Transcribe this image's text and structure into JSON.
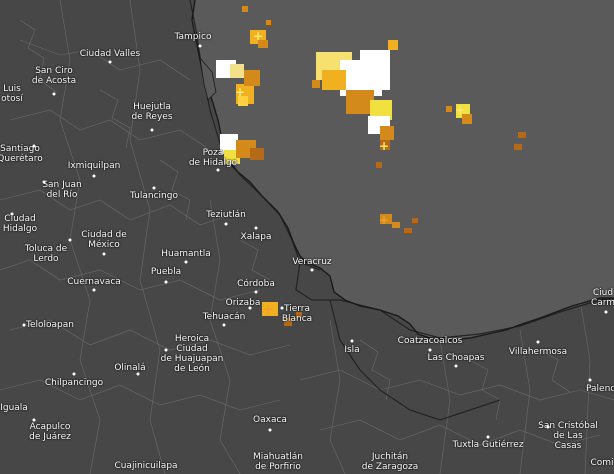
{
  "map": {
    "colors": {
      "land": "#474747",
      "sea": "#5a5a5a",
      "borders": "#6b6b6b",
      "coast": "#1f1f1f",
      "roads": "#2a2a2a"
    },
    "cities": [
      {
        "id": "tampico",
        "label": "Tampico"
      },
      {
        "id": "ciudad-valles",
        "label": "Ciudad Valles"
      },
      {
        "id": "san-ciro",
        "label": "San Ciro\nde Acosta"
      },
      {
        "id": "luis-potosi",
        "label": "Luis\notosí"
      },
      {
        "id": "huejutla",
        "label": "Huejutla\nde Reyes"
      },
      {
        "id": "santiago-queretaro",
        "label": "Santiago\nQuerétaro"
      },
      {
        "id": "ixmiquilpan",
        "label": "Ixmiquilpan"
      },
      {
        "id": "poza-rica",
        "label": "Poza\nde Hidalgo"
      },
      {
        "id": "san-juan-rio",
        "label": "San Juan\ndel Río"
      },
      {
        "id": "tulancingo",
        "label": "Tulancingo"
      },
      {
        "id": "ciudad-hidalgo",
        "label": "Ciudad\nHidalgo"
      },
      {
        "id": "teziutlan",
        "label": "Teziutlán"
      },
      {
        "id": "toluca",
        "label": "Toluca de\nLerdo"
      },
      {
        "id": "ciudad-mexico",
        "label": "Ciudad de\nMéxico"
      },
      {
        "id": "xalapa",
        "label": "Xalapa"
      },
      {
        "id": "huamantla",
        "label": "Huamantla"
      },
      {
        "id": "veracruz",
        "label": "Veracruz"
      },
      {
        "id": "puebla",
        "label": "Puebla"
      },
      {
        "id": "cuernavaca",
        "label": "Cuernavaca"
      },
      {
        "id": "cordoba",
        "label": "Córdoba"
      },
      {
        "id": "orizaba",
        "label": "Orizaba"
      },
      {
        "id": "tierra-blanca",
        "label": "Tierra\nBlanca"
      },
      {
        "id": "tehuacan",
        "label": "Tehuacán"
      },
      {
        "id": "teloloapan",
        "label": "Teloloapan"
      },
      {
        "id": "huajuapan",
        "label": "Heroica\nCiudad\nde Huajuapan\nde León"
      },
      {
        "id": "isla",
        "label": "Isla"
      },
      {
        "id": "coatzacoalcos",
        "label": "Coatzacoalcos"
      },
      {
        "id": "las-choapas",
        "label": "Las Choapas"
      },
      {
        "id": "villahermosa",
        "label": "Villahermosa"
      },
      {
        "id": "chilpancingo",
        "label": "Chilpancingo"
      },
      {
        "id": "olinala",
        "label": "Olinalá"
      },
      {
        "id": "acapulco",
        "label": "Acapulco\nde Juárez"
      },
      {
        "id": "oaxaca",
        "label": "Oaxaca"
      },
      {
        "id": "miahuatlan",
        "label": "Miahuatlán\nde Porfirio"
      },
      {
        "id": "juchitan",
        "label": "Juchitán\nde Zaragoza"
      },
      {
        "id": "tuxtla",
        "label": "Tuxtla Gutiérrez"
      },
      {
        "id": "san-cristobal",
        "label": "San Cristóbal\nde Las\nCasas"
      },
      {
        "id": "palenque",
        "label": "Palenq"
      },
      {
        "id": "cuajinicuilapa",
        "label": "Cuajinicuilapa"
      },
      {
        "id": "comitan",
        "label": "Comi"
      },
      {
        "id": "ciudad-carmen",
        "label": "Ciud\nCarm"
      },
      {
        "id": "iguala",
        "label": "Iguala"
      }
    ]
  }
}
